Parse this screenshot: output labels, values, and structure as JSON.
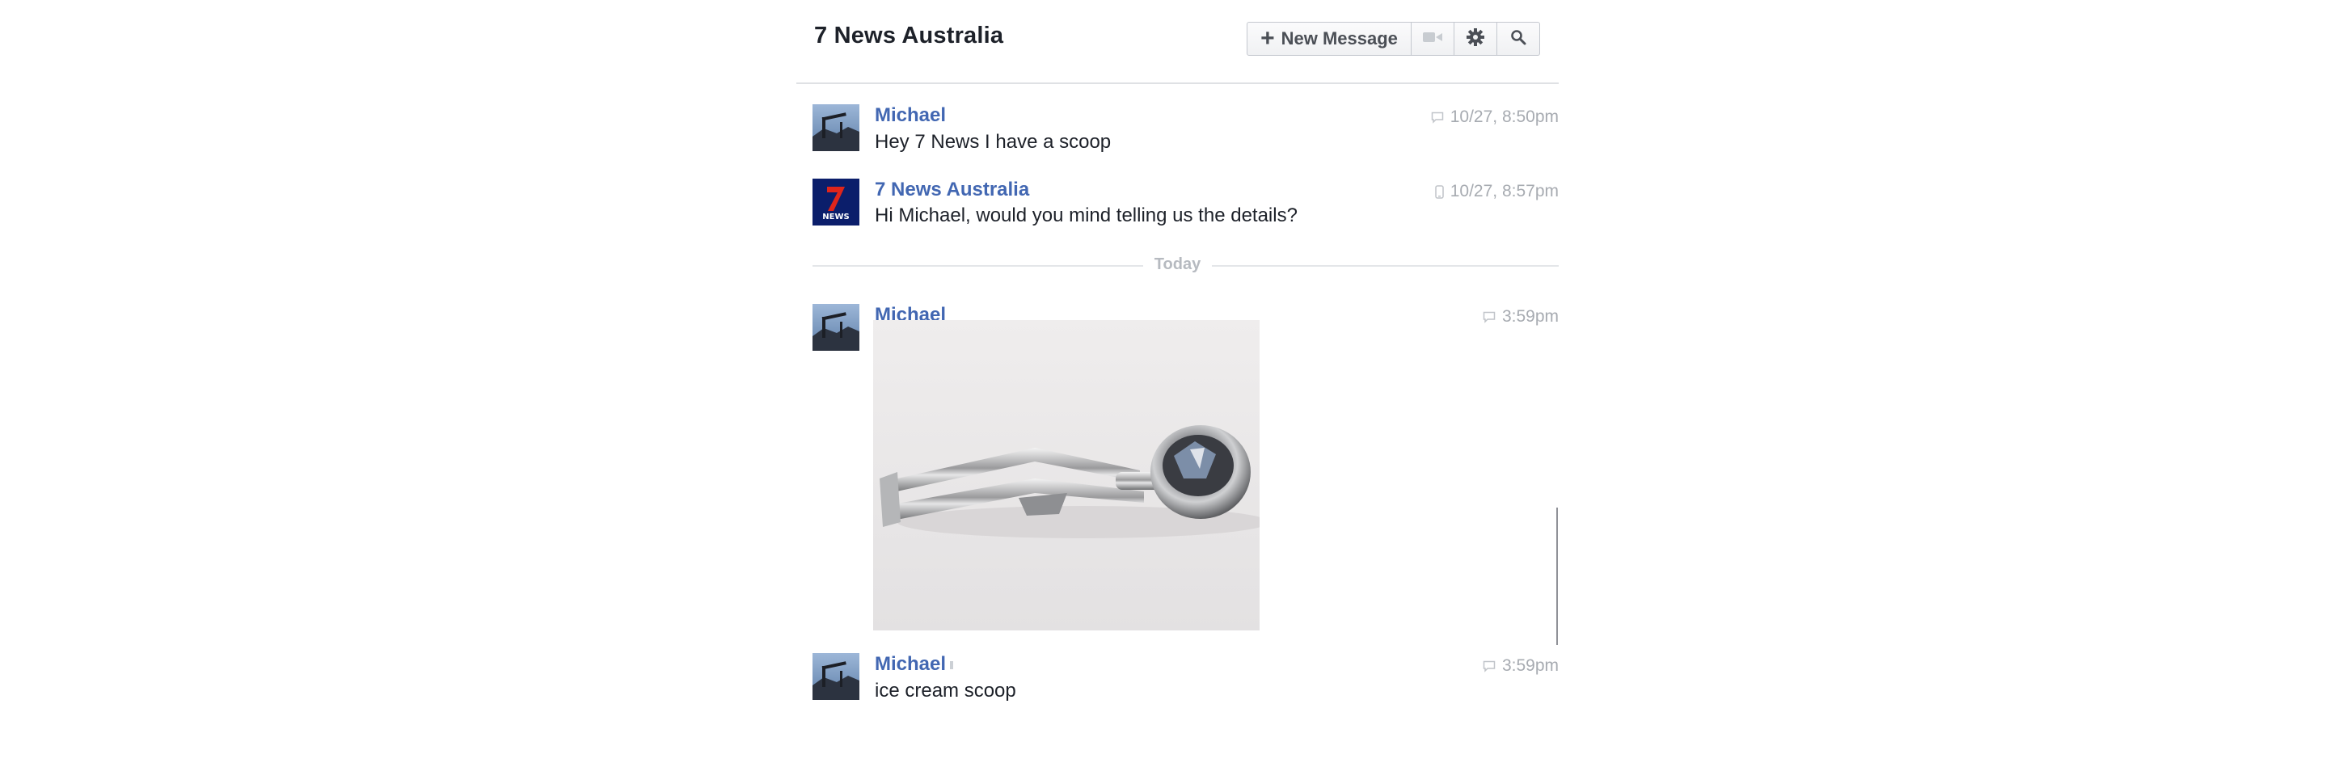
{
  "conversation": {
    "title": "7 News Australia"
  },
  "toolbar": {
    "new_message_label": "New Message",
    "icons": [
      "plus-icon",
      "video-camera-icon",
      "gear-icon",
      "search-icon"
    ]
  },
  "messages": [
    {
      "sender": "Michael",
      "text": "Hey 7 News I have a scoop",
      "timestamp": "10/27, 8:50pm",
      "source_icon": "chat-bubble-icon"
    },
    {
      "sender": "7 News Australia",
      "text": "Hi Michael, would you mind telling us the details?",
      "timestamp": "10/27, 8:57pm",
      "source_icon": "mobile-phone-icon"
    },
    {
      "sender": "Michael",
      "text": "",
      "timestamp": "3:59pm",
      "source_icon": "chat-bubble-icon",
      "attachment": "ice-cream-scoop-photo"
    },
    {
      "sender": "Michael",
      "text": "ice cream scoop",
      "timestamp": "3:59pm",
      "source_icon": "chat-bubble-icon"
    }
  ],
  "day_divider": "Today",
  "colors": {
    "sender_link": "#4267b2",
    "muted": "#a7abb1",
    "divider": "#e4e6e9"
  }
}
